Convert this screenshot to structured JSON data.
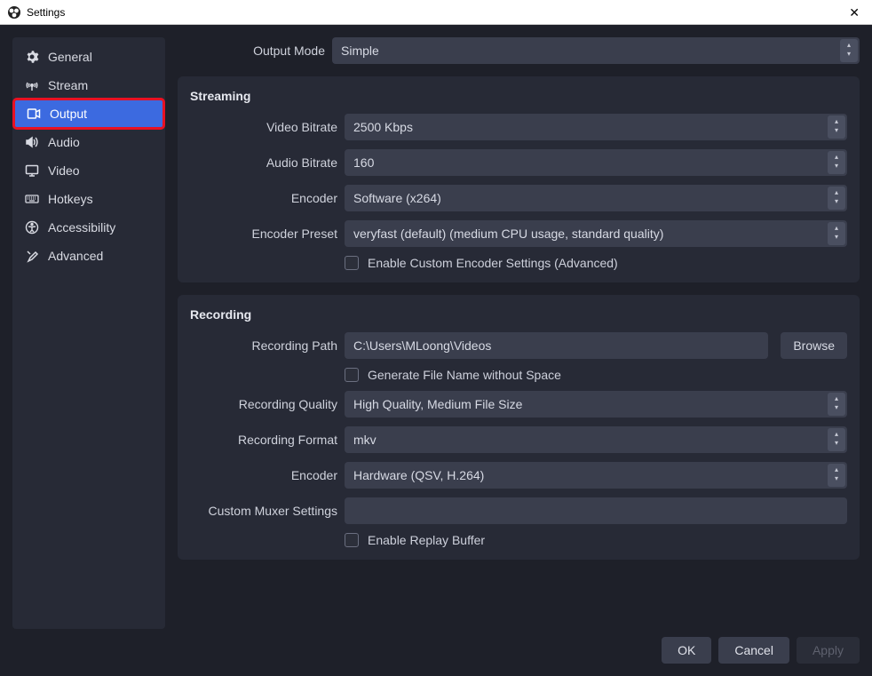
{
  "window": {
    "title": "Settings"
  },
  "sidebar": {
    "items": [
      {
        "label": "General"
      },
      {
        "label": "Stream"
      },
      {
        "label": "Output"
      },
      {
        "label": "Audio"
      },
      {
        "label": "Video"
      },
      {
        "label": "Hotkeys"
      },
      {
        "label": "Accessibility"
      },
      {
        "label": "Advanced"
      }
    ]
  },
  "output_mode": {
    "label": "Output Mode",
    "value": "Simple"
  },
  "streaming": {
    "title": "Streaming",
    "video_bitrate": {
      "label": "Video Bitrate",
      "value": "2500 Kbps"
    },
    "audio_bitrate": {
      "label": "Audio Bitrate",
      "value": "160"
    },
    "encoder": {
      "label": "Encoder",
      "value": "Software (x264)"
    },
    "encoder_preset": {
      "label": "Encoder Preset",
      "value": "veryfast (default) (medium CPU usage, standard quality)"
    },
    "enable_custom": {
      "label": "Enable Custom Encoder Settings (Advanced)"
    }
  },
  "recording": {
    "title": "Recording",
    "path": {
      "label": "Recording Path",
      "value": "C:\\Users\\MLoong\\Videos",
      "browse": "Browse"
    },
    "generate_no_space": {
      "label": "Generate File Name without Space"
    },
    "quality": {
      "label": "Recording Quality",
      "value": "High Quality, Medium File Size"
    },
    "format": {
      "label": "Recording Format",
      "value": "mkv"
    },
    "encoder": {
      "label": "Encoder",
      "value": "Hardware (QSV, H.264)"
    },
    "muxer": {
      "label": "Custom Muxer Settings",
      "value": ""
    },
    "replay_buffer": {
      "label": "Enable Replay Buffer"
    }
  },
  "footer": {
    "ok": "OK",
    "cancel": "Cancel",
    "apply": "Apply"
  }
}
